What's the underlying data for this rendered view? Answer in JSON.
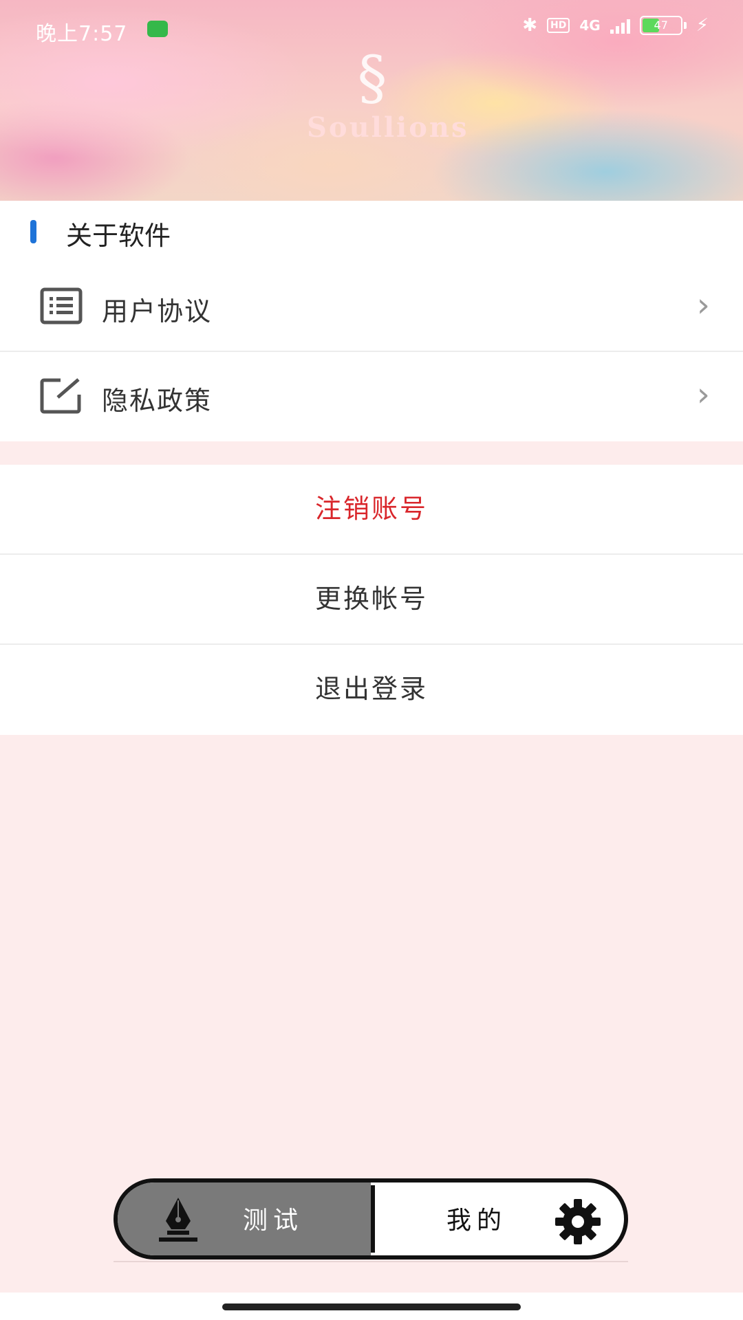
{
  "status_bar": {
    "time": "晚上7:57",
    "network": "4G",
    "hd": "HD",
    "battery": "47"
  },
  "header": {
    "logo_text": "Soullions"
  },
  "about_section": {
    "title": "关于软件",
    "accent_color": "#1e73d8",
    "items": [
      {
        "label": "用户协议",
        "icon": "list-icon"
      },
      {
        "label": "隐私政策",
        "icon": "edit-icon"
      }
    ]
  },
  "actions": {
    "cancel_account": "注销账号",
    "switch_account": "更换帐号",
    "logout": "退出登录",
    "danger_color": "#d9262b"
  },
  "tabbar": {
    "tabs": [
      {
        "label": "测试",
        "icon": "pen-nib-icon",
        "active": true
      },
      {
        "label": "我的",
        "icon": "gear-icon",
        "active": false
      }
    ]
  }
}
